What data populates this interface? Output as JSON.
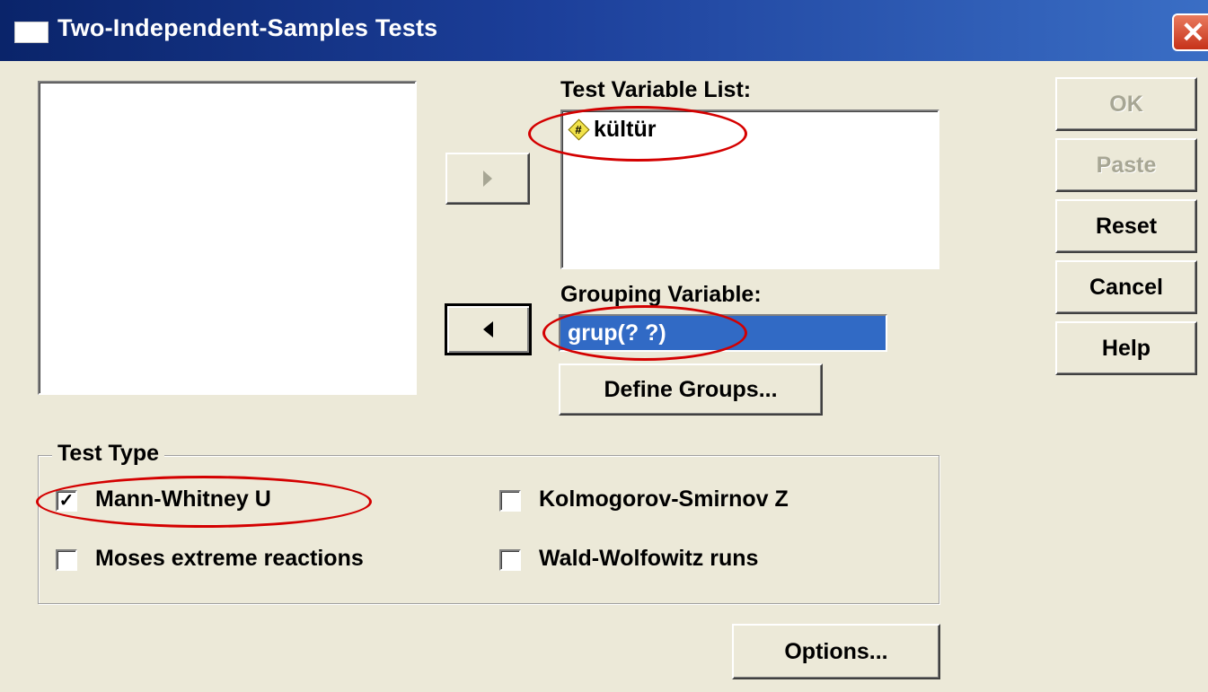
{
  "window": {
    "title": "Two-Independent-Samples Tests",
    "close_label": "✕"
  },
  "source_list": {
    "items": []
  },
  "test_variable": {
    "label": "Test Variable List:",
    "items": [
      {
        "name": "kültür",
        "icon": "scale-variable-icon"
      }
    ]
  },
  "grouping_variable": {
    "label": "Grouping Variable:",
    "value": "grup(? ?)"
  },
  "buttons": {
    "move_right_icon": "arrow-right-icon",
    "move_left_icon": "arrow-left-icon",
    "define_groups": "Define Groups...",
    "ok": "OK",
    "paste": "Paste",
    "reset": "Reset",
    "cancel": "Cancel",
    "help": "Help",
    "options": "Options..."
  },
  "test_type": {
    "title": "Test Type",
    "options": [
      {
        "label": "Mann-Whitney U",
        "checked": true
      },
      {
        "label": "Kolmogorov-Smirnov Z",
        "checked": false
      },
      {
        "label": "Moses extreme reactions",
        "checked": false
      },
      {
        "label": "Wald-Wolfowitz runs",
        "checked": false
      }
    ]
  },
  "annotations": {
    "color": "#d40000"
  }
}
